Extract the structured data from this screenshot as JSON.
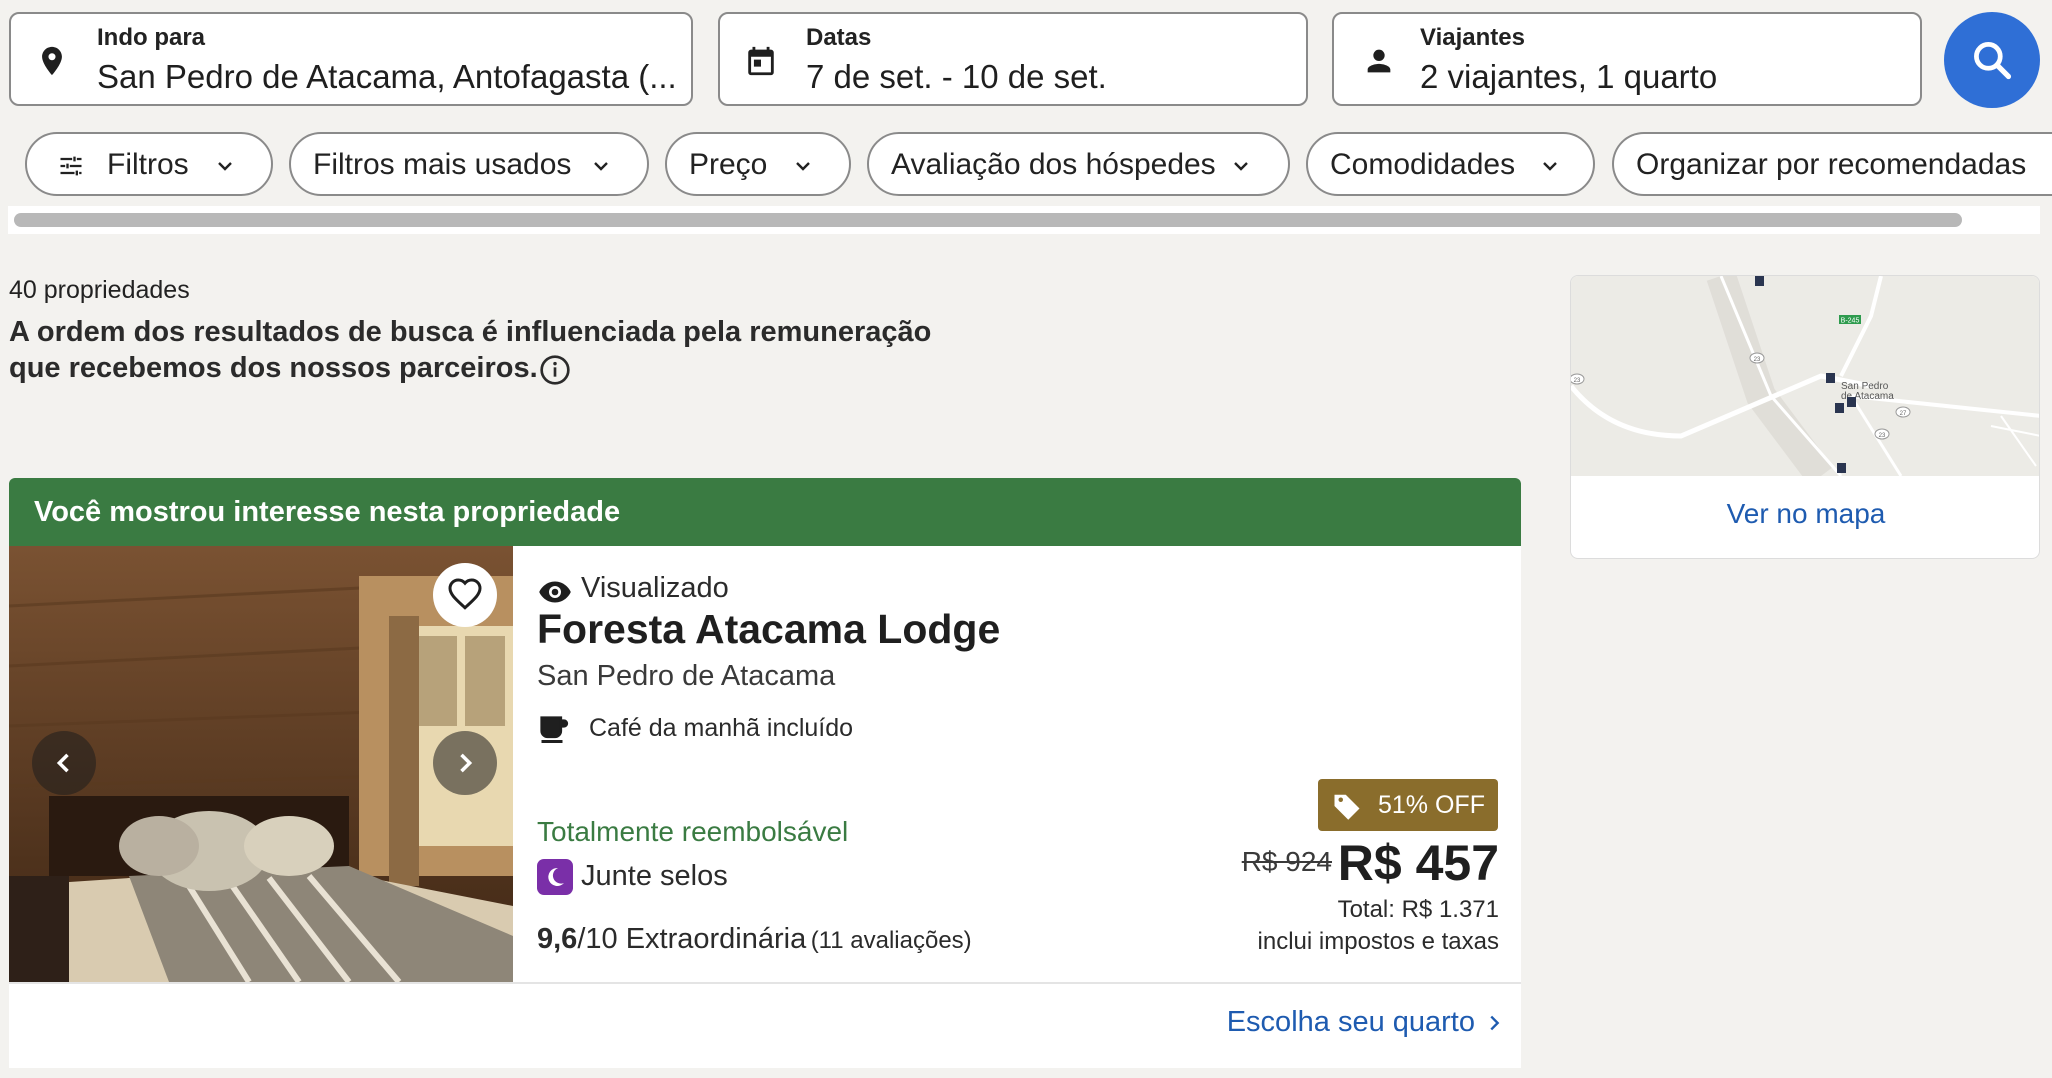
{
  "search": {
    "destination": {
      "label": "Indo para",
      "value": "San Pedro de Atacama, Antofagasta (..."
    },
    "dates": {
      "label": "Datas",
      "value": "7 de set. - 10 de set."
    },
    "travelers": {
      "label": "Viajantes",
      "value": "2 viajantes, 1 quarto"
    }
  },
  "filters": [
    {
      "label": "Filtros"
    },
    {
      "label": "Filtros mais usados"
    },
    {
      "label": "Preço"
    },
    {
      "label": "Avaliação dos hóspedes"
    },
    {
      "label": "Comodidades"
    },
    {
      "label": "Organizar por recomendadas"
    }
  ],
  "results": {
    "count": "40 propriedades",
    "disclaimer_line1": "A ordem dos resultados de busca é influenciada pela remuneração",
    "disclaimer_line2": "que recebemos dos nossos parceiros."
  },
  "map": {
    "link": "Ver no mapa",
    "town_line1": "San Pedro",
    "town_line2": "de Atacama",
    "road_b245": "B-245",
    "road_23a": "23",
    "road_23b": "23",
    "road_27": "27",
    "road_23c": "23"
  },
  "card": {
    "banner": "Você mostrou interesse nesta propriedade",
    "viewed": "Visualizado",
    "name": "Foresta Atacama Lodge",
    "location": "San Pedro de Atacama",
    "amenity": "Café da manhã incluído",
    "refundable": "Totalmente reembolsável",
    "stamps": "Junte selos",
    "rating_score": "9,6",
    "rating_scale": "/10 Extraordinária",
    "rating_count": "(11 avaliações)",
    "discount": "51% OFF",
    "old_price": "R$ 924",
    "price": "R$ 457",
    "total": "Total: R$ 1.371",
    "taxes": "inclui impostos e taxas",
    "cta": "Escolha seu quarto"
  },
  "colors": {
    "accent": "#2f6fd6",
    "banner": "#3a7b42",
    "refundable": "#3a7b42",
    "discount_badge": "#8a6d2c",
    "link": "#1e5bb0"
  }
}
